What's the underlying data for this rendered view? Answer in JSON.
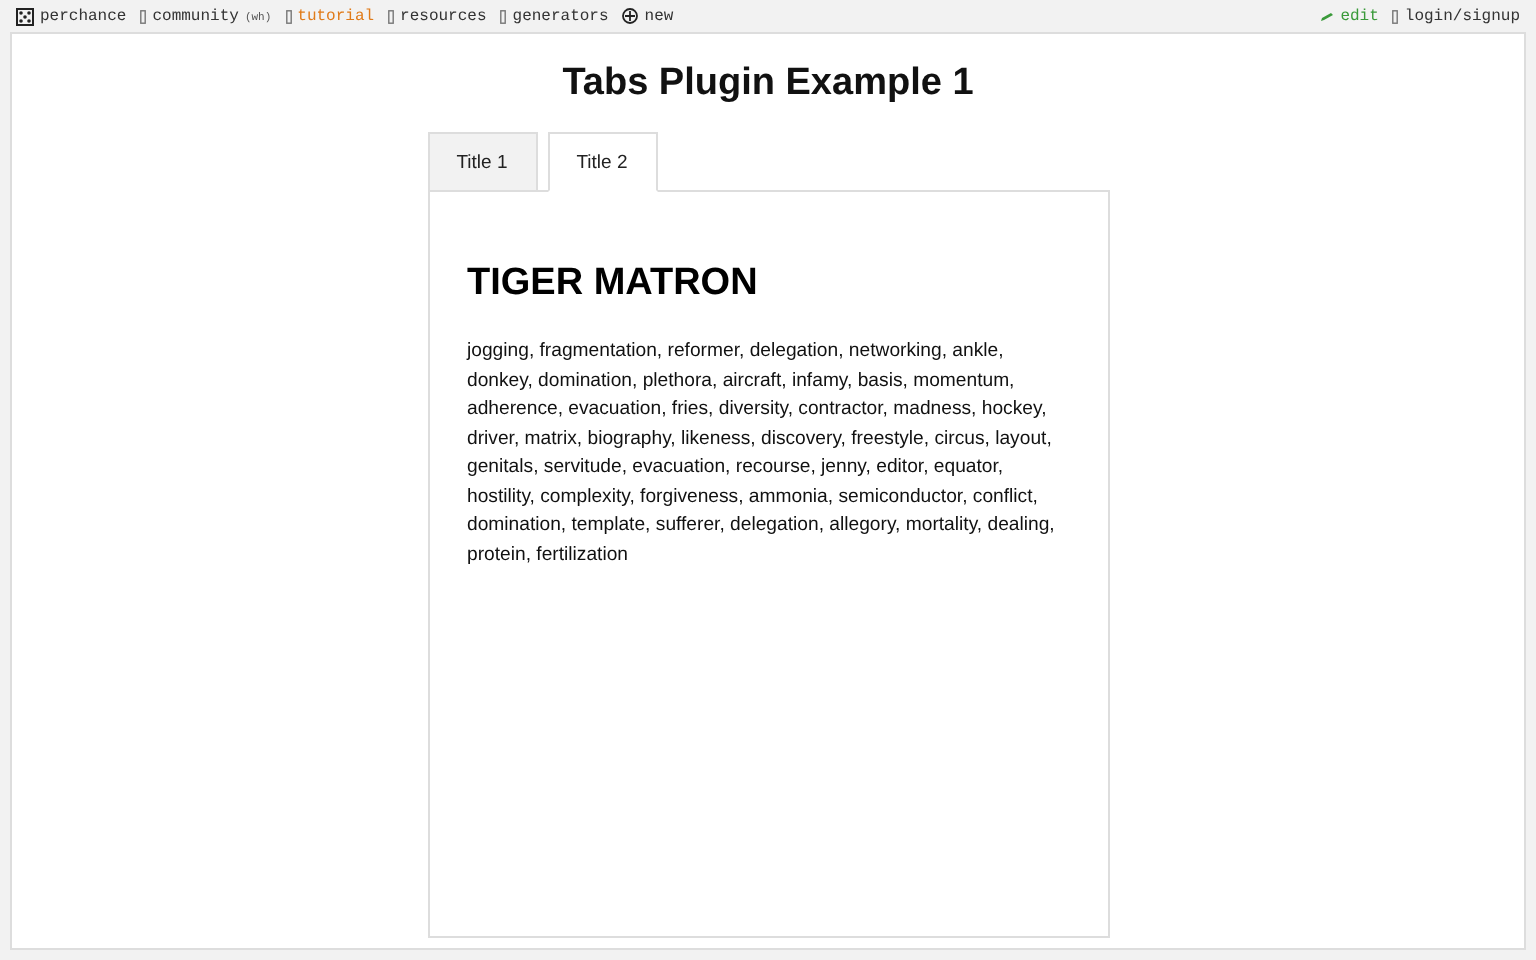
{
  "nav_left": [
    {
      "kind": "dice",
      "label": "perchance",
      "color": "#333333"
    },
    {
      "kind": "box",
      "label": "community",
      "count": "(wh)",
      "color": "#333333"
    },
    {
      "kind": "box",
      "label": "tutorial",
      "color": "#e07b1a"
    },
    {
      "kind": "box",
      "label": "resources",
      "color": "#333333"
    },
    {
      "kind": "box",
      "label": "generators",
      "color": "#333333"
    },
    {
      "kind": "plus",
      "label": "new",
      "color": "#333333"
    }
  ],
  "nav_right": [
    {
      "kind": "pencil",
      "label": "edit",
      "color": "#3a9a3a"
    },
    {
      "kind": "box",
      "label": "login/signup",
      "color": "#333333"
    }
  ],
  "page_title": "Tabs Plugin Example 1",
  "tabs": [
    {
      "label": "Title 1",
      "selected": false
    },
    {
      "label": "Title 2",
      "selected": true
    }
  ],
  "panel": {
    "heading": "TIGER MATRON",
    "text": "jogging, fragmentation, reformer, delegation, networking, ankle, donkey, domination, plethora, aircraft, infamy, basis, momentum, adherence, evacuation, fries, diversity, contractor, madness, hockey, driver, matrix, biography, likeness, discovery, freestyle, circus, layout, genitals, servitude, evacuation, recourse, jenny, editor, equator, hostility, complexity, forgiveness, ammonia, semiconductor, conflict, domination, template, sufferer, delegation, allegory, mortality, dealing, protein, fertilization"
  }
}
